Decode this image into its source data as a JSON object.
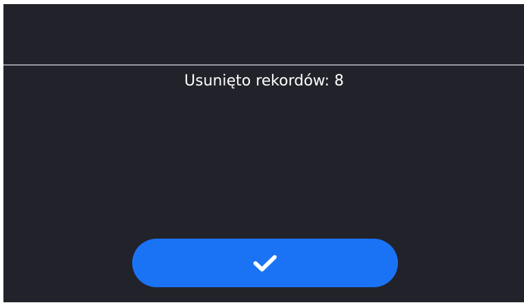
{
  "dialog": {
    "message": "Usunięto rekordów: 8"
  },
  "confirm_button": {
    "icon": "check-icon"
  },
  "colors": {
    "background": "#22222b",
    "divider": "#9a9aa6",
    "text": "#ffffff",
    "accent": "#1a73f5"
  }
}
